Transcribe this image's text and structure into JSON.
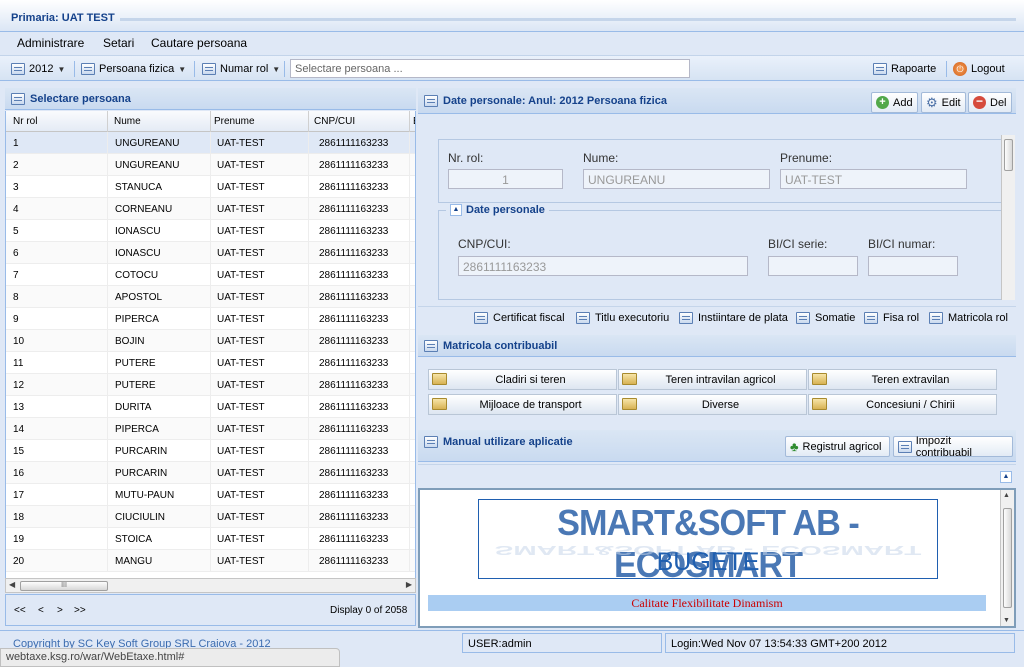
{
  "header": {
    "title": "Primaria: UAT TEST"
  },
  "menu": {
    "items": [
      "Administrare",
      "Setari",
      "Cautare persoana"
    ]
  },
  "toolbar": {
    "year": "2012",
    "person_type": "Persoana fizica",
    "numar_rol": "Numar rol",
    "search_placeholder": "Selectare persoana ...",
    "rapoarte": "Rapoarte",
    "logout": "Logout"
  },
  "left_panel": {
    "title": "Selectare persoana",
    "columns": [
      "Nr rol",
      "Nume",
      "Prenume",
      "CNP/CUI",
      "E"
    ],
    "rows": [
      [
        "1",
        "UNGUREANU",
        "UAT-TEST",
        "2861111163233"
      ],
      [
        "2",
        "UNGUREANU",
        "UAT-TEST",
        "2861111163233"
      ],
      [
        "3",
        "STANUCA",
        "UAT-TEST",
        "2861111163233"
      ],
      [
        "4",
        "CORNEANU",
        "UAT-TEST",
        "2861111163233"
      ],
      [
        "5",
        "IONASCU",
        "UAT-TEST",
        "2861111163233"
      ],
      [
        "6",
        "IONASCU",
        "UAT-TEST",
        "2861111163233"
      ],
      [
        "7",
        "COTOCU",
        "UAT-TEST",
        "2861111163233"
      ],
      [
        "8",
        "APOSTOL",
        "UAT-TEST",
        "2861111163233"
      ],
      [
        "9",
        "PIPERCA",
        "UAT-TEST",
        "2861111163233"
      ],
      [
        "10",
        "BOJIN",
        "UAT-TEST",
        "2861111163233"
      ],
      [
        "11",
        "PUTERE",
        "UAT-TEST",
        "2861111163233"
      ],
      [
        "12",
        "PUTERE",
        "UAT-TEST",
        "2861111163233"
      ],
      [
        "13",
        "DURITA",
        "UAT-TEST",
        "2861111163233"
      ],
      [
        "14",
        "PIPERCA",
        "UAT-TEST",
        "2861111163233"
      ],
      [
        "15",
        "PURCARIN",
        "UAT-TEST",
        "2861111163233"
      ],
      [
        "16",
        "PURCARIN",
        "UAT-TEST",
        "2861111163233"
      ],
      [
        "17",
        "MUTU-PAUN",
        "UAT-TEST",
        "2861111163233"
      ],
      [
        "18",
        "CIUCIULIN",
        "UAT-TEST",
        "2861111163233"
      ],
      [
        "19",
        "STOICA",
        "UAT-TEST",
        "2861111163233"
      ],
      [
        "20",
        "MANGU",
        "UAT-TEST",
        "2861111163233"
      ]
    ],
    "scroll_thumb": "III",
    "pager": {
      "first": "<<",
      "prev": "<",
      "next": ">",
      "last": ">>",
      "display": "Display 0 of 2058"
    }
  },
  "details": {
    "title": "Date personale: Anul: 2012 Persoana fizica",
    "add": "Add",
    "edit": "Edit",
    "del": "Del",
    "nr_rol_label": "Nr. rol:",
    "nr_rol_value": "1",
    "nume_label": "Nume:",
    "nume_value": "UNGUREANU",
    "prenume_label": "Prenume:",
    "prenume_value": "UAT-TEST",
    "section_title": "Date personale",
    "cnp_label": "CNP/CUI:",
    "cnp_value": "2861111163233",
    "bi_serie_label": "BI/CI serie:",
    "bi_numar_label": "BI/CI numar:",
    "links": [
      "Certificat fiscal",
      "Titlu executoriu",
      "Instiintare de plata",
      "Somatie",
      "Fisa rol",
      "Matricola rol"
    ]
  },
  "matricola": {
    "title": "Matricola contribuabil",
    "buttons": [
      "Cladiri si teren",
      "Teren intravilan agricol",
      "Teren extravilan",
      "Mijloace de transport",
      "Diverse",
      "Concesiuni / Chirii"
    ]
  },
  "manual": {
    "title": "Manual utilizare aplicatie",
    "registru": "Registrul agricol",
    "impozit": "Impozit contribuabil"
  },
  "banner": {
    "brand": "SMART&SOFT AB - ECOSMART",
    "sub": "BUGETE",
    "tagline": "Calitate Flexibilitate Dinamism"
  },
  "footer": {
    "copyright": "Copyright by SC Key Soft Group SRL Craiova - 2012",
    "user": "USER:admin",
    "login": "Login:Wed Nov 07 13:54:33 GMT+200 2012"
  },
  "statusbar": {
    "url": "webtaxe.ksg.ro/war/WebEtaxe.html#"
  },
  "colors": {
    "panel": "#dfe8f6",
    "title": "#15428b",
    "border": "#99bbe8",
    "brand_blue": "#1f5fb0",
    "tagline_red": "#cc0000"
  }
}
